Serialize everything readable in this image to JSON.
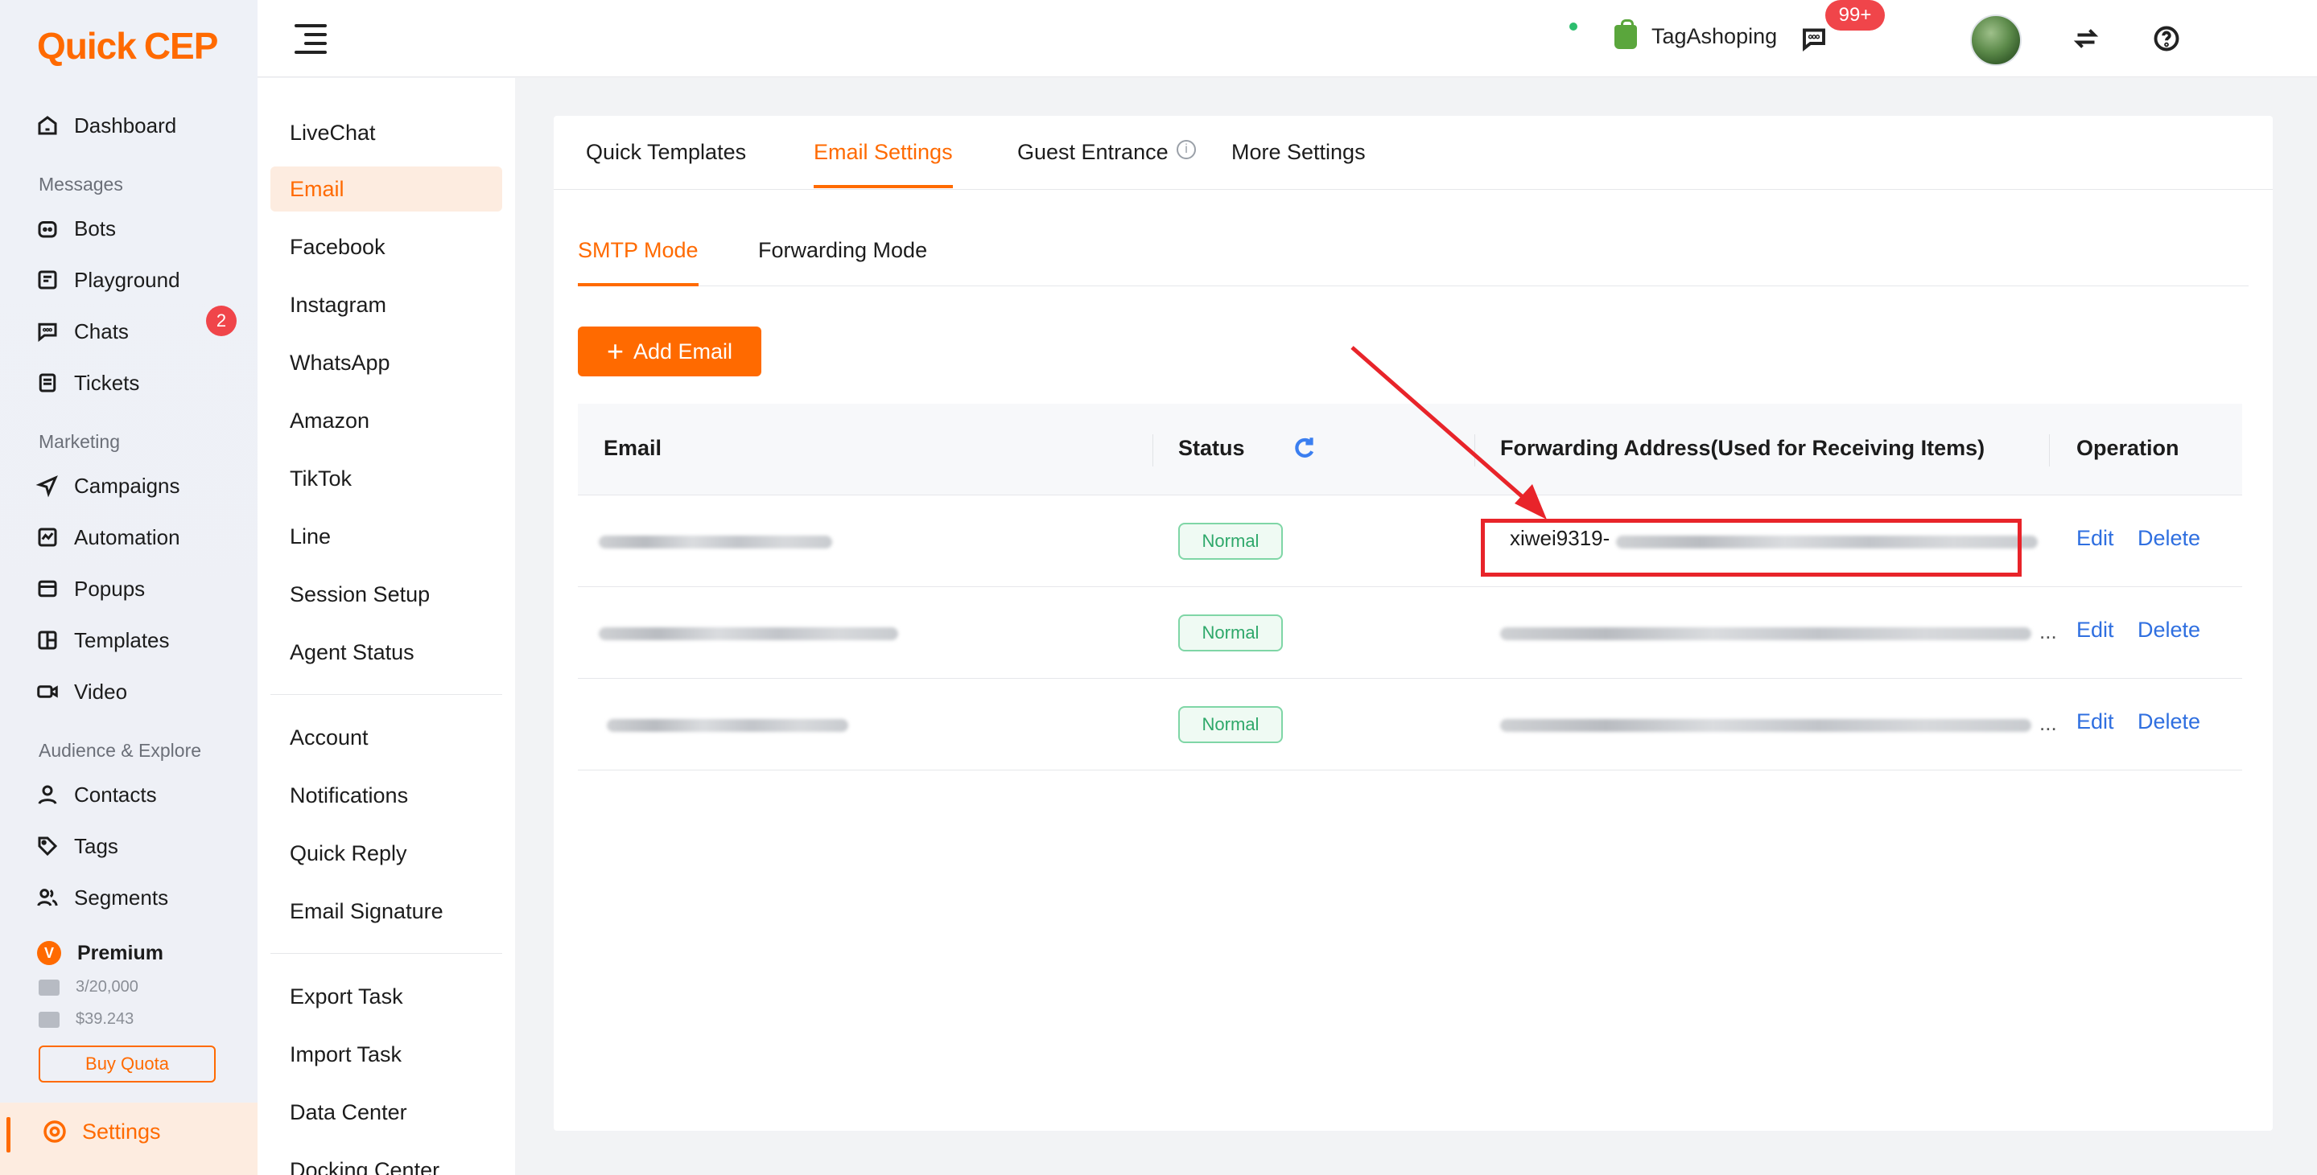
{
  "app": {
    "brand_q": "Q",
    "brand_rest": "uick",
    "brand_cep": "CEP"
  },
  "sidebar": {
    "items": [
      {
        "label": "Dashboard",
        "icon": "home-icon"
      },
      {
        "section": "Messages"
      },
      {
        "label": "Bots",
        "icon": "bot-icon"
      },
      {
        "label": "Playground",
        "icon": "playground-icon"
      },
      {
        "label": "Chats",
        "icon": "chat-icon",
        "badge": "2"
      },
      {
        "label": "Tickets",
        "icon": "ticket-icon"
      },
      {
        "section": "Marketing"
      },
      {
        "label": "Campaigns",
        "icon": "send-icon"
      },
      {
        "label": "Automation",
        "icon": "automation-icon"
      },
      {
        "label": "Popups",
        "icon": "popup-icon"
      },
      {
        "label": "Templates",
        "icon": "template-icon"
      },
      {
        "label": "Video",
        "icon": "video-icon"
      },
      {
        "section": "Audience & Explore"
      },
      {
        "label": "Contacts",
        "icon": "contact-icon"
      },
      {
        "label": "Tags",
        "icon": "tag-icon"
      },
      {
        "label": "Segments",
        "icon": "segments-icon"
      }
    ],
    "plan": {
      "name": "Premium",
      "badge": "V",
      "emails": "3/20,000",
      "balance": "$39.243",
      "buy_label": "Buy Quota"
    },
    "settings_label": "Settings"
  },
  "topbar": {
    "store_name": "TagAshoping",
    "notification_count": "99+"
  },
  "subnav": {
    "group1": [
      "LiveChat",
      "Email",
      "Facebook",
      "Instagram",
      "WhatsApp",
      "Amazon",
      "TikTok",
      "Line",
      "Session Setup",
      "Agent Status"
    ],
    "group2": [
      "Account",
      "Notifications",
      "Quick Reply",
      "Email Signature"
    ],
    "group3": [
      "Export Task",
      "Import Task",
      "Data Center",
      "Docking Center"
    ],
    "active": "Email"
  },
  "tabs": {
    "primary": [
      "Quick Templates",
      "Email Settings",
      "Guest Entrance",
      "More Settings"
    ],
    "primary_active": "Email Settings",
    "secondary": [
      "SMTP Mode",
      "Forwarding Mode"
    ],
    "secondary_active": "SMTP Mode"
  },
  "add_email_label": "Add Email",
  "table": {
    "headers": {
      "email": "Email",
      "status": "Status",
      "forwarding": "Forwarding Address(Used for Receiving Items)",
      "operation": "Operation"
    },
    "rows": [
      {
        "status": "Normal",
        "forwarding_prefix": "xiwei9319-",
        "edit": "Edit",
        "delete": "Delete"
      },
      {
        "status": "Normal",
        "forwarding_prefix": "",
        "edit": "Edit",
        "delete": "Delete"
      },
      {
        "status": "Normal",
        "forwarding_prefix": "",
        "edit": "Edit",
        "delete": "Delete"
      }
    ]
  },
  "colors": {
    "accent": "#ff6a00",
    "link": "#2f6fe0",
    "status_green": "#2ea86a",
    "annotation_red": "#e8242a"
  }
}
